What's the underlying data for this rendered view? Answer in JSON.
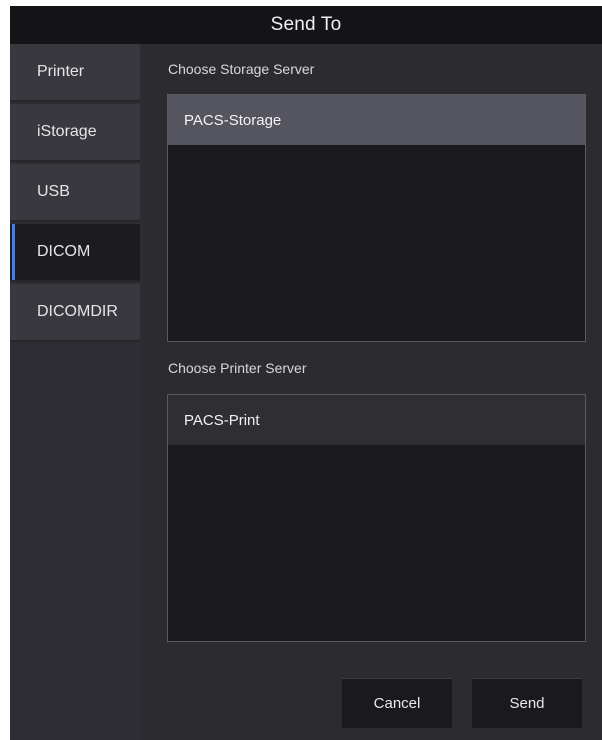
{
  "dialog": {
    "title": "Send To"
  },
  "sidebar": {
    "items": [
      {
        "label": "Printer"
      },
      {
        "label": "iStorage"
      },
      {
        "label": "USB"
      },
      {
        "label": "DICOM"
      },
      {
        "label": "DICOMDIR"
      }
    ],
    "active": "DICOM"
  },
  "storage": {
    "label": "Choose Storage Server",
    "servers": [
      {
        "name": "PACS-Storage",
        "selected": true
      }
    ]
  },
  "printer": {
    "label": "Choose Printer Server",
    "servers": [
      {
        "name": "PACS-Print",
        "selected": false
      }
    ]
  },
  "buttons": {
    "cancel": "Cancel",
    "send": "Send"
  },
  "colors": {
    "accent": "#3d7fe8",
    "background": "#2c2c30",
    "titlebar": "#141417"
  }
}
